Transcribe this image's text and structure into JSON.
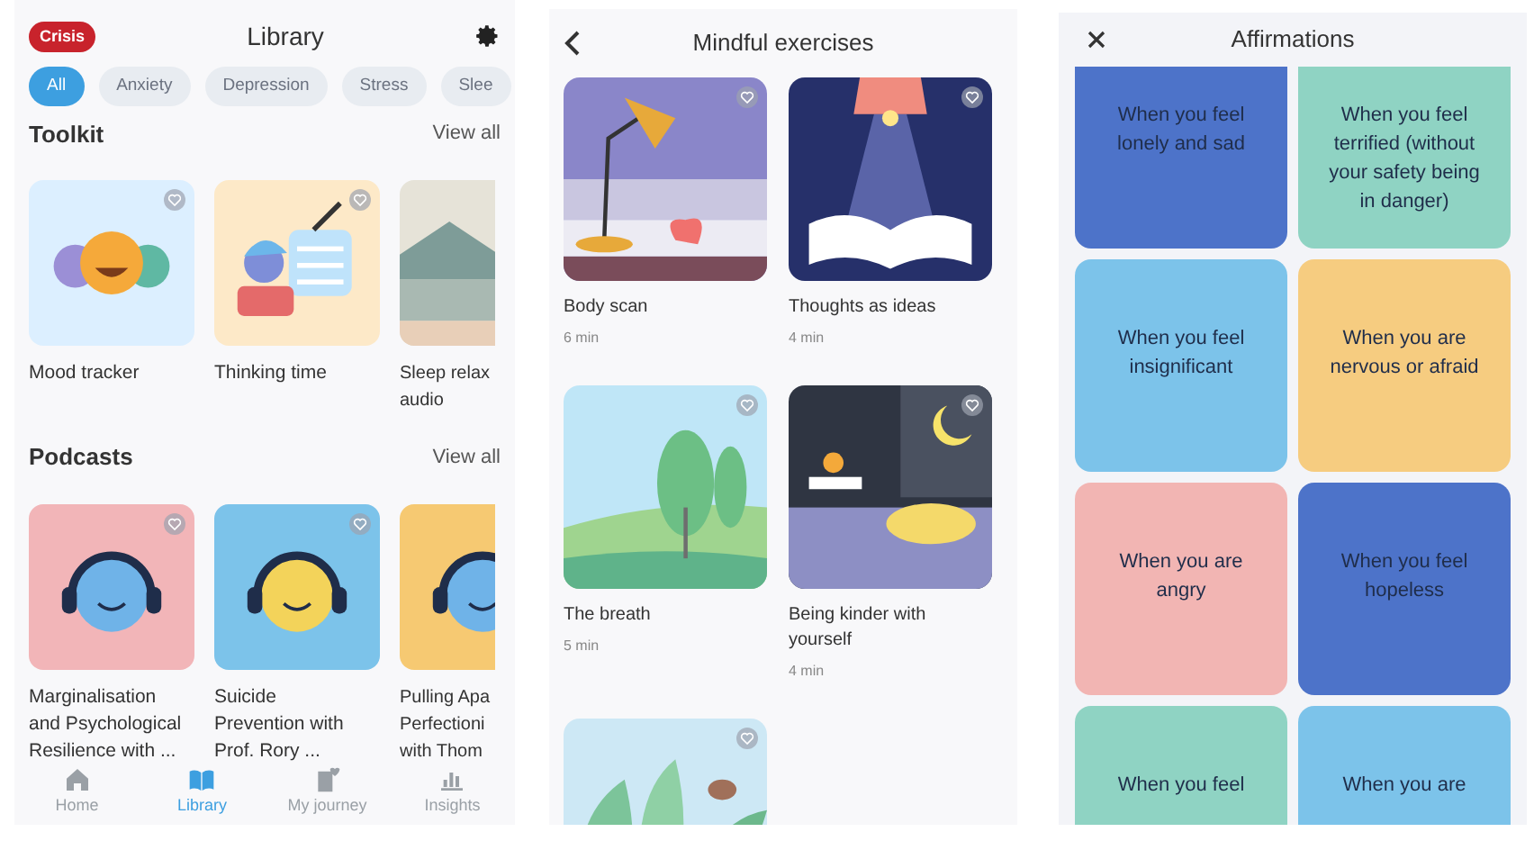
{
  "library": {
    "crisis_button": "Crisis",
    "title": "Library",
    "chips": [
      {
        "label": "All",
        "selected": true
      },
      {
        "label": "Anxiety",
        "selected": false
      },
      {
        "label": "Depression",
        "selected": false
      },
      {
        "label": "Stress",
        "selected": false
      },
      {
        "label": "Slee",
        "selected": false
      }
    ],
    "sections": [
      {
        "title": "Toolkit",
        "view_all": "View all",
        "items": [
          {
            "kind": "faces",
            "title_lines": [
              "Mood tracker"
            ]
          },
          {
            "kind": "person",
            "title_lines": [
              "Thinking time"
            ]
          },
          {
            "kind": "lake",
            "title_lines": [
              "Sleep relax",
              "audio"
            ]
          }
        ]
      },
      {
        "title": "Podcasts",
        "view_all": "View all",
        "items": [
          {
            "kind": "headphones",
            "color": "#f2b5b8",
            "title_lines": [
              "Marginalisation",
              "and Psychological",
              "Resilience with ..."
            ]
          },
          {
            "kind": "headphones",
            "color": "#7cc3ea",
            "title_lines": [
              "Suicide",
              "Prevention with",
              "Prof. Rory ..."
            ]
          },
          {
            "kind": "headphones",
            "color": "#f6c972",
            "title_lines": [
              "Pulling Apa",
              "Perfectioni",
              "with Thom"
            ]
          }
        ]
      }
    ],
    "nav": [
      {
        "label": "Home",
        "selected": false
      },
      {
        "label": "Library",
        "selected": true
      },
      {
        "label": "My journey",
        "selected": false
      },
      {
        "label": "Insights",
        "selected": false
      }
    ]
  },
  "mindful": {
    "title": "Mindful exercises",
    "items": [
      {
        "kind": "lamp",
        "title": "Body scan",
        "duration": "6 min"
      },
      {
        "kind": "book",
        "title": "Thoughts as ideas",
        "duration": "4 min"
      },
      {
        "kind": "trees",
        "title": "The breath",
        "duration": "5 min"
      },
      {
        "kind": "cat",
        "title": "Being kinder with yourself",
        "duration": "4 min"
      },
      {
        "kind": "leaves"
      }
    ]
  },
  "affirmations": {
    "title": "Affirmations",
    "tiles": [
      {
        "text": "When you feel lonely and sad",
        "color": "#4d73c9"
      },
      {
        "text": "When you feel terrified (without your safety being in danger)",
        "color": "#8fd3c3"
      },
      {
        "text": "When you feel insignificant",
        "color": "#7cc3ea"
      },
      {
        "text": "When you are nervous or afraid",
        "color": "#f6cc80"
      },
      {
        "text": "When you are angry",
        "color": "#f2b5b3"
      },
      {
        "text": "When you feel hopeless",
        "color": "#4d73c9"
      },
      {
        "text": "When you feel",
        "color": "#8fd3c3"
      },
      {
        "text": "When you are",
        "color": "#7cc3ea"
      }
    ]
  }
}
